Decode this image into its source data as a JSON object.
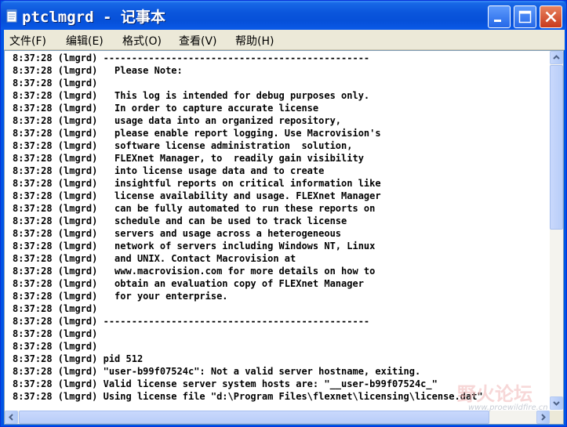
{
  "window": {
    "title": "ptclmgrd - 记事本"
  },
  "menu": {
    "items": [
      "文件(F)",
      "编辑(E)",
      "格式(O)",
      "查看(V)",
      "帮助(H)"
    ]
  },
  "editor": {
    "lines": [
      "8:37:28 (lmgrd) -----------------------------------------------",
      "8:37:28 (lmgrd)   Please Note:",
      "8:37:28 (lmgrd)",
      "8:37:28 (lmgrd)   This log is intended for debug purposes only.",
      "8:37:28 (lmgrd)   In order to capture accurate license",
      "8:37:28 (lmgrd)   usage data into an organized repository,",
      "8:37:28 (lmgrd)   please enable report logging. Use Macrovision's",
      "8:37:28 (lmgrd)   software license administration  solution,",
      "8:37:28 (lmgrd)   FLEXnet Manager, to  readily gain visibility",
      "8:37:28 (lmgrd)   into license usage data and to create",
      "8:37:28 (lmgrd)   insightful reports on critical information like",
      "8:37:28 (lmgrd)   license availability and usage. FLEXnet Manager",
      "8:37:28 (lmgrd)   can be fully automated to run these reports on",
      "8:37:28 (lmgrd)   schedule and can be used to track license",
      "8:37:28 (lmgrd)   servers and usage across a heterogeneous",
      "8:37:28 (lmgrd)   network of servers including Windows NT, Linux",
      "8:37:28 (lmgrd)   and UNIX. Contact Macrovision at",
      "8:37:28 (lmgrd)   www.macrovision.com for more details on how to",
      "8:37:28 (lmgrd)   obtain an evaluation copy of FLEXnet Manager",
      "8:37:28 (lmgrd)   for your enterprise.",
      "8:37:28 (lmgrd)",
      "8:37:28 (lmgrd) -----------------------------------------------",
      "8:37:28 (lmgrd)",
      "8:37:28 (lmgrd)",
      "8:37:28 (lmgrd) pid 512",
      "8:37:28 (lmgrd) \"user-b99f07524c\": Not a valid server hostname, exiting.",
      "8:37:28 (lmgrd) Valid license server system hosts are: \"__user-b99f07524c_\"",
      "8:37:28 (lmgrd) Using license file \"d:\\Program Files\\flexnet\\licensing\\license.dat\""
    ]
  },
  "watermark": {
    "text": "野火论坛",
    "url": "www.proewildfire.cn"
  },
  "colors": {
    "titlebar": "#0a56dc",
    "close_button": "#c8391c",
    "menubar": "#ece9d8"
  }
}
